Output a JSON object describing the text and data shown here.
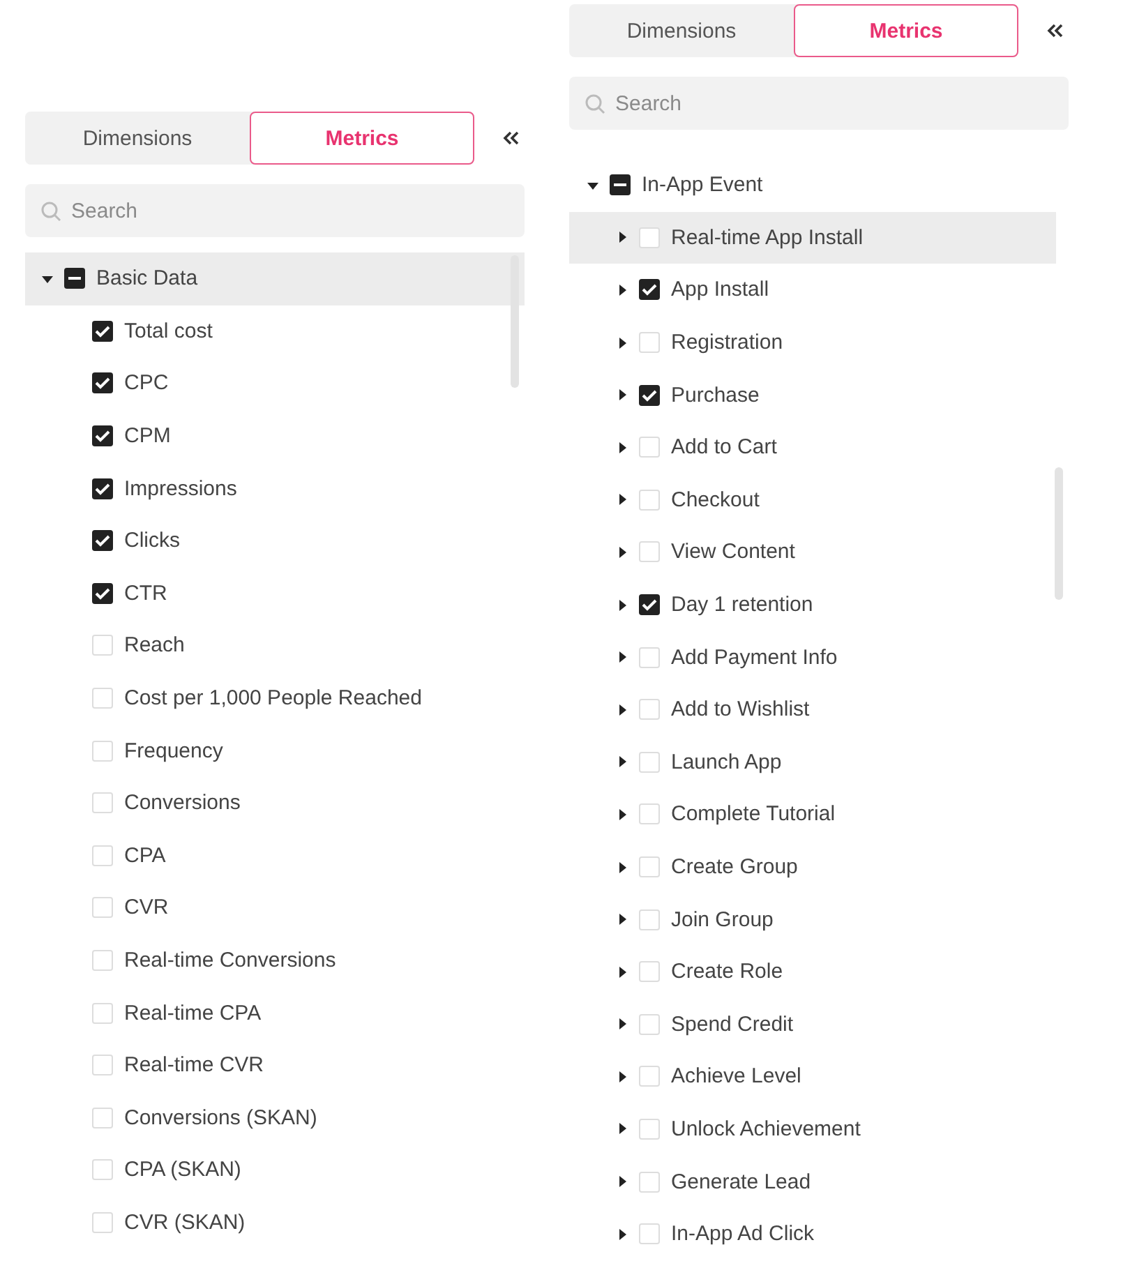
{
  "panels": [
    {
      "tabs": [
        {
          "label": "Dimensions",
          "selected": false
        },
        {
          "label": "Metrics",
          "selected": true
        }
      ],
      "search": {
        "placeholder": "Search"
      },
      "groups": [
        {
          "label": "Basic Data",
          "expanded": true,
          "indeterminate": true,
          "highlighted": true,
          "children": [
            {
              "label": "Total cost",
              "checked": true
            },
            {
              "label": "CPC",
              "checked": true
            },
            {
              "label": "CPM",
              "checked": true
            },
            {
              "label": "Impressions",
              "checked": true
            },
            {
              "label": "Clicks",
              "checked": true
            },
            {
              "label": "CTR",
              "checked": true
            },
            {
              "label": "Reach",
              "checked": false
            },
            {
              "label": "Cost per 1,000 People Reached",
              "checked": false
            },
            {
              "label": "Frequency",
              "checked": false
            },
            {
              "label": "Conversions",
              "checked": false
            },
            {
              "label": "CPA",
              "checked": false
            },
            {
              "label": "CVR",
              "checked": false
            },
            {
              "label": "Real-time Conversions",
              "checked": false
            },
            {
              "label": "Real-time CPA",
              "checked": false
            },
            {
              "label": "Real-time CVR",
              "checked": false
            },
            {
              "label": "Conversions (SKAN)",
              "checked": false
            },
            {
              "label": "CPA (SKAN)",
              "checked": false
            },
            {
              "label": "CVR (SKAN)",
              "checked": false
            }
          ]
        }
      ]
    },
    {
      "tabs": [
        {
          "label": "Dimensions",
          "selected": false
        },
        {
          "label": "Metrics",
          "selected": true
        }
      ],
      "search": {
        "placeholder": "Search"
      },
      "groups": [
        {
          "label": "In-App Event",
          "expanded": true,
          "indeterminate": true,
          "highlighted": false,
          "children": [
            {
              "label": "Real-time App Install",
              "checked": false,
              "expanded": false,
              "highlighted": true
            },
            {
              "label": "App Install",
              "checked": true,
              "expanded": false
            },
            {
              "label": "Registration",
              "checked": false,
              "expanded": false
            },
            {
              "label": "Purchase",
              "checked": true,
              "expanded": false
            },
            {
              "label": "Add to Cart",
              "checked": false,
              "expanded": false
            },
            {
              "label": "Checkout",
              "checked": false,
              "expanded": false
            },
            {
              "label": "View Content",
              "checked": false,
              "expanded": false
            },
            {
              "label": "Day 1 retention",
              "checked": true,
              "expanded": false
            },
            {
              "label": "Add Payment Info",
              "checked": false,
              "expanded": false
            },
            {
              "label": "Add to Wishlist",
              "checked": false,
              "expanded": false
            },
            {
              "label": "Launch App",
              "checked": false,
              "expanded": false
            },
            {
              "label": "Complete Tutorial",
              "checked": false,
              "expanded": false
            },
            {
              "label": "Create Group",
              "checked": false,
              "expanded": false
            },
            {
              "label": "Join Group",
              "checked": false,
              "expanded": false
            },
            {
              "label": "Create Role",
              "checked": false,
              "expanded": false
            },
            {
              "label": "Spend Credit",
              "checked": false,
              "expanded": false
            },
            {
              "label": "Achieve Level",
              "checked": false,
              "expanded": false
            },
            {
              "label": "Unlock Achievement",
              "checked": false,
              "expanded": false
            },
            {
              "label": "Generate Lead",
              "checked": false,
              "expanded": false
            },
            {
              "label": "In-App Ad Click",
              "checked": false,
              "expanded": false
            }
          ]
        }
      ]
    }
  ]
}
